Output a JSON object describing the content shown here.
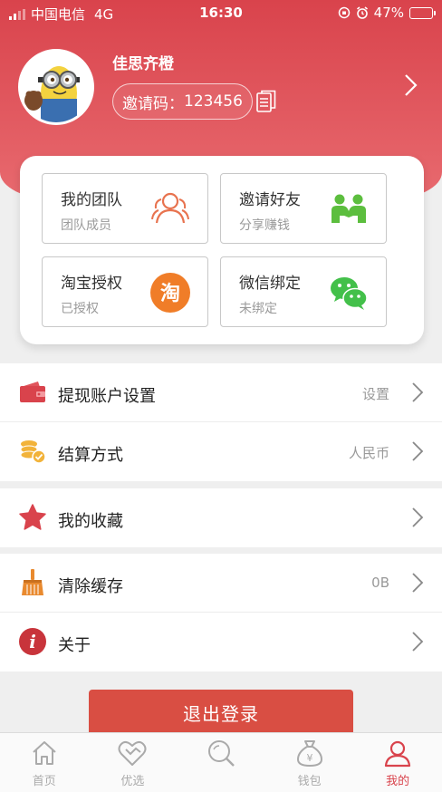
{
  "status_bar": {
    "carrier": "中国电信",
    "network": "4G",
    "time": "16:30",
    "battery": "47%",
    "battery_level": 0.47
  },
  "profile": {
    "username": "佳思齐橙",
    "invite_label": "邀请码：",
    "invite_code": "123456"
  },
  "card": {
    "tiles": [
      {
        "title": "我的团队",
        "sub": "团队成员",
        "icon": "team-icon"
      },
      {
        "title": "邀请好友",
        "sub": "分享赚钱",
        "icon": "friends-icon"
      },
      {
        "title": "淘宝授权",
        "sub": "已授权",
        "icon": "taobao-icon",
        "icon_text": "淘"
      },
      {
        "title": "微信绑定",
        "sub": "未绑定",
        "icon": "wechat-icon"
      }
    ]
  },
  "menu": {
    "withdraw": {
      "label": "提现账户设置",
      "value": "设置",
      "icon": "wallet-icon"
    },
    "settlement": {
      "label": "结算方式",
      "value": "人民币",
      "icon": "coins-icon"
    },
    "favorites": {
      "label": "我的收藏",
      "value": "",
      "icon": "star-icon"
    },
    "cache": {
      "label": "清除缓存",
      "value": "0B",
      "icon": "broom-icon"
    },
    "about": {
      "label": "关于",
      "value": "",
      "icon": "info-icon",
      "icon_text": "i"
    }
  },
  "logout_label": "退出登录",
  "tabbar": [
    {
      "label": "首页",
      "icon": "home-icon",
      "active": false
    },
    {
      "label": "优选",
      "icon": "heart-icon",
      "active": false
    },
    {
      "label": "",
      "icon": "search-icon",
      "active": false
    },
    {
      "label": "钱包",
      "icon": "money-bag-icon",
      "icon_text": "¥",
      "active": false
    },
    {
      "label": "我的",
      "icon": "user-icon",
      "active": true
    }
  ],
  "colors": {
    "brand_red": "#d9434c",
    "header_gradient_end": "#e86a6f",
    "logout_red": "#d94e43",
    "team_orange": "#e8734f",
    "friends_green": "#5cbe3e",
    "taobao_orange": "#f07d28",
    "wechat_green": "#43c04a",
    "coin_yellow": "#f2b33a",
    "broom_orange": "#e98a2f"
  }
}
